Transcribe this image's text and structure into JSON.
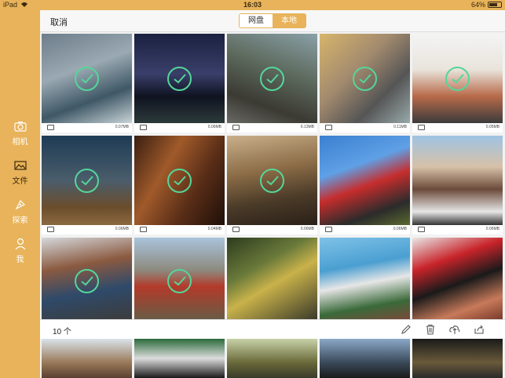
{
  "status": {
    "device": "iPad",
    "time": "16:03",
    "battery": "64%",
    "battery_level": 0.64
  },
  "sidebar": {
    "items": [
      {
        "label": "相机",
        "icon": "camera-icon"
      },
      {
        "label": "文件",
        "icon": "image-icon",
        "active": true
      },
      {
        "label": "探索",
        "icon": "compass-icon"
      },
      {
        "label": "我",
        "icon": "user-icon"
      }
    ]
  },
  "header": {
    "cancel": "取消",
    "tab_cloud": "网盘",
    "tab_local": "本地"
  },
  "tiles": [
    {
      "size": "0.07MB"
    },
    {
      "size": "0.06MB"
    },
    {
      "size": "0.13MB"
    },
    {
      "size": "0.11MB"
    },
    {
      "size": "0.05MB"
    },
    {
      "size": "0.06MB"
    },
    {
      "size": "0.04MB"
    },
    {
      "size": "0.06MB"
    },
    {
      "size": "0.06MB"
    },
    {
      "size": "0.06MB"
    }
  ],
  "bottombar": {
    "count": "10 个"
  },
  "colors": {
    "accent": "#e8b35a",
    "check": "#54d69a"
  }
}
